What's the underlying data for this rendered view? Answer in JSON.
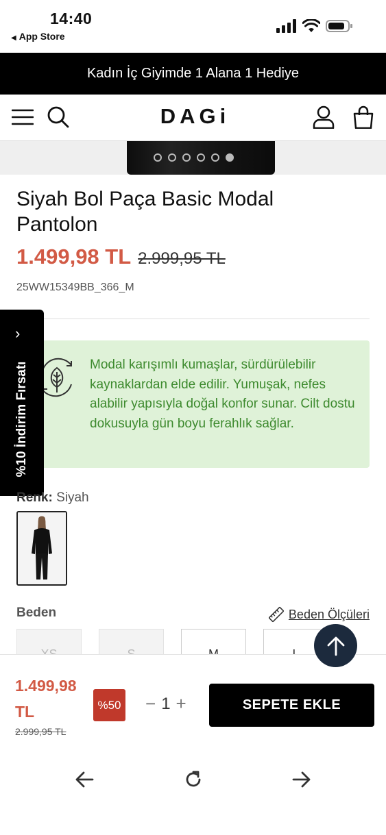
{
  "status_bar": {
    "time": "14:40",
    "back_app": "App Store",
    "icons": [
      "signal-icon",
      "wifi-icon",
      "battery-icon"
    ]
  },
  "promo_banner": {
    "text": "Kadın İç Giyimde 1 Alana 1 Hediye"
  },
  "header": {
    "logo": "DAGi",
    "icons": [
      "menu-icon",
      "search-icon",
      "account-icon",
      "cart-icon"
    ]
  },
  "gallery": {
    "dot_count": 6,
    "active_index": 5
  },
  "product": {
    "title": "Siyah Bol Paça Basic Modal Pantolon",
    "price_current": "1.499,98 TL",
    "price_original": "2.999,95 TL",
    "sku": "25WW15349BB_366_M"
  },
  "side_tab": {
    "label": "%10 İndirim Fırsatı"
  },
  "info_box": {
    "icon": "eco-leaf-icon",
    "text": "Modal karışımlı kumaşlar, sürdürülebilir kaynaklardan elde edilir. Yumuşak, nefes alabilir yapısıyla doğal konfor sunar. Cilt dostu dokusuyla gün boyu ferahlık sağlar."
  },
  "color": {
    "label": "Renk:",
    "value": "Siyah"
  },
  "size": {
    "label": "Beden",
    "guide_label": "Beden Ölçüleri",
    "options": [
      {
        "label": "XS",
        "available": false
      },
      {
        "label": "S",
        "available": false
      },
      {
        "label": "M",
        "available": true
      },
      {
        "label": "L",
        "available": true
      }
    ]
  },
  "buy_bar": {
    "price_current": "1.499,98 TL",
    "price_original": "2.999,95 TL",
    "discount_badge": "%50",
    "quantity": "1",
    "add_to_cart": "SEPETE EKLE"
  },
  "accent_colors": {
    "price_red": "#d25a45",
    "info_green": "#3d8a2e",
    "info_bg": "#dff2d8",
    "badge_red": "#c0392b",
    "fab_navy": "#1c2a3d"
  }
}
